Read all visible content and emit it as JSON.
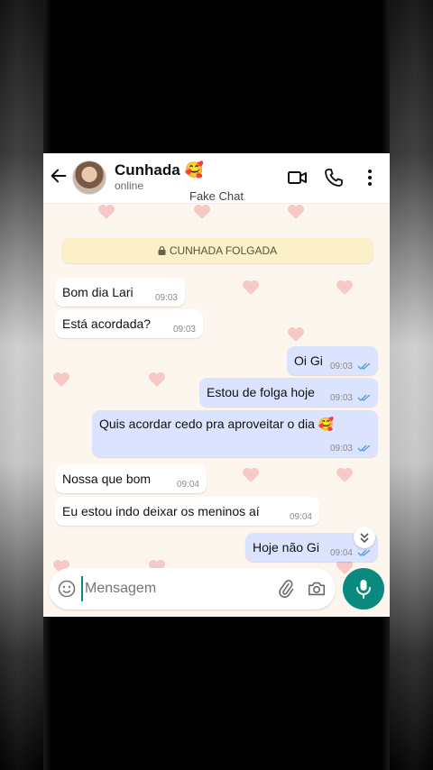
{
  "header": {
    "contact_name": "Cunhada 🥰",
    "status": "online",
    "subtitle": "Fake Chat"
  },
  "banner": {
    "label": "CUNHADA FOLGADA"
  },
  "messages": [
    {
      "direction": "in",
      "text": "Bom dia Lari",
      "time": "09:03"
    },
    {
      "direction": "in",
      "text": "Está acordada?",
      "time": "09:03"
    },
    {
      "direction": "out",
      "text": "Oi Gi",
      "time": "09:03"
    },
    {
      "direction": "out",
      "text": "Estou de folga hoje",
      "time": "09:03"
    },
    {
      "direction": "out",
      "text": "Quis acordar cedo pra aproveitar o dia 🥰",
      "time": "09:03"
    },
    {
      "direction": "in",
      "text": "Nossa que bom",
      "time": "09:04"
    },
    {
      "direction": "in",
      "text": "Eu estou indo deixar os meninos aí",
      "time": "09:04"
    },
    {
      "direction": "out",
      "text": "Hoje não Gi",
      "time": "09:04"
    }
  ],
  "composer": {
    "placeholder": "Mensagem"
  },
  "colors": {
    "accent": "#0a8a7e",
    "outgoing_bubble": "#dbe3ff",
    "banner": "#fbf0c8",
    "read_tick": "#4fa3e0"
  },
  "icons": [
    "back-arrow-icon",
    "video-call-icon",
    "phone-call-icon",
    "more-options-icon",
    "lock-icon",
    "double-check-icon",
    "scroll-down-icon",
    "emoji-icon",
    "attach-icon",
    "camera-icon",
    "mic-icon"
  ]
}
